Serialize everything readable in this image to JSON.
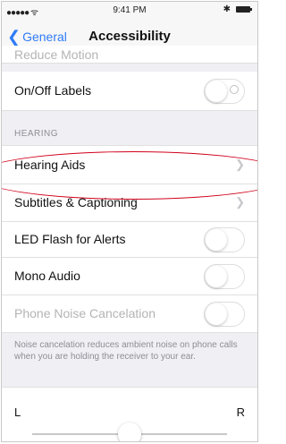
{
  "status_bar": {
    "time": "9:41 PM"
  },
  "nav": {
    "back_label": "General",
    "title": "Accessibility"
  },
  "rows_top": [
    {
      "label": "Reduce Motion"
    },
    {
      "label": "On/Off Labels"
    }
  ],
  "hearing": {
    "header": "HEARING",
    "rows": [
      {
        "label": "Hearing Aids"
      },
      {
        "label": "Subtitles & Captioning"
      },
      {
        "label": "LED Flash for Alerts"
      },
      {
        "label": "Mono Audio"
      },
      {
        "label": "Phone Noise Cancelation"
      }
    ],
    "note": "Noise cancelation reduces ambient noise on phone calls when you are holding the receiver to your ear."
  },
  "balance": {
    "left": "L",
    "right": "R",
    "position": 0.5
  },
  "colors": {
    "accent": "#2f7cf6",
    "highlight": "#d0021b"
  },
  "icons": [
    "wifi-icon",
    "battery-icon",
    "chevron-left-icon",
    "chevron-right-icon"
  ]
}
